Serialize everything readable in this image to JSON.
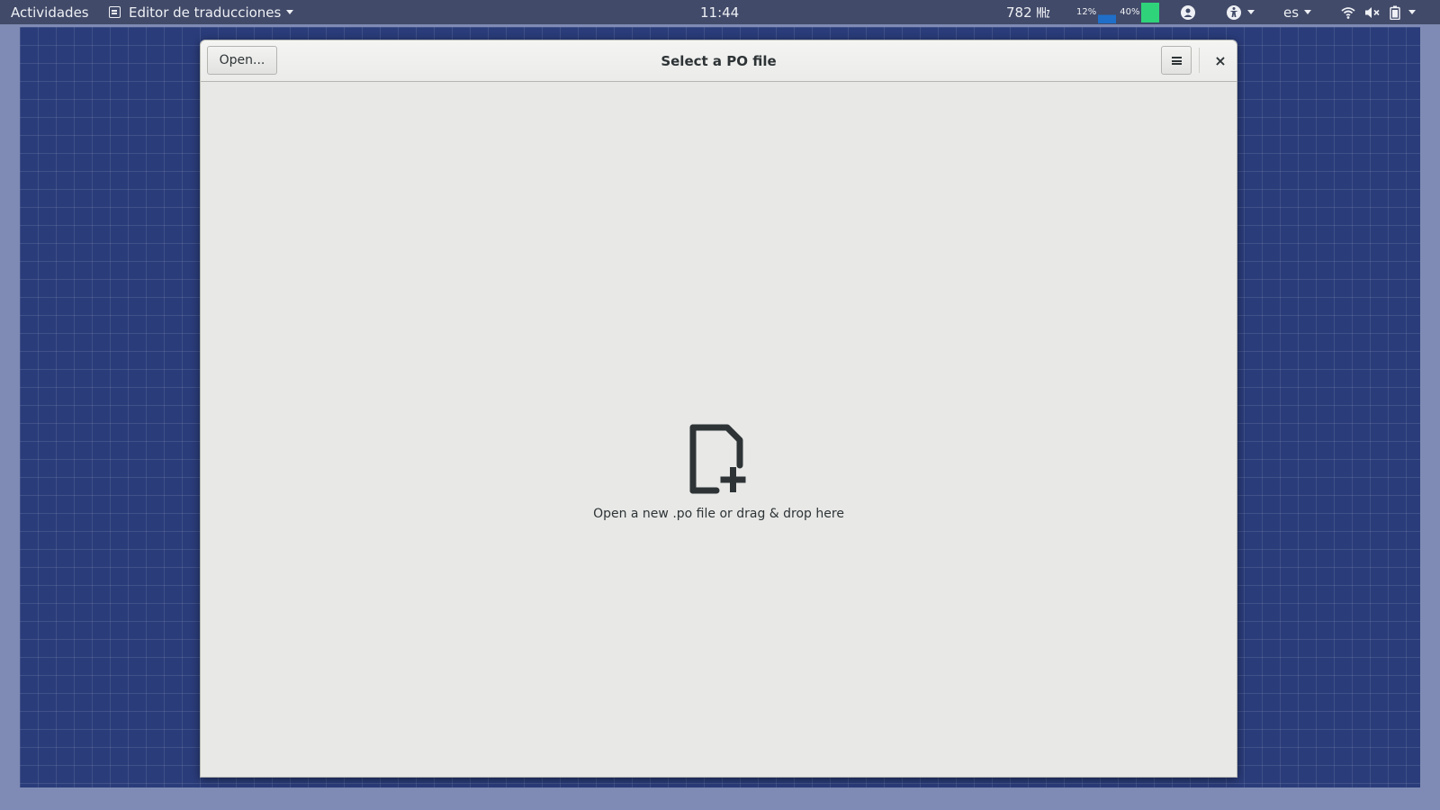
{
  "topbar": {
    "activities": "Actividades",
    "app_menu": "Editor de traducciones",
    "clock": "11:44",
    "cpu_freq": "782 ㎒",
    "cpu_load": "12%",
    "mem_load": "40%",
    "keyboard_layout": "es",
    "icons": [
      "app-icon",
      "cpu-graph",
      "memory-graph",
      "account-icon",
      "accessibility-icon",
      "wifi-icon",
      "volume-muted-icon",
      "battery-icon"
    ]
  },
  "window": {
    "title": "Select a PO file",
    "open_label": "Open...",
    "close_glyph": "×",
    "placeholder_text": "Open a new .po file or drag & drop here",
    "placeholder_icon": "document-add-icon"
  },
  "colors": {
    "topbar_bg": "#414a68",
    "wallpaper": "#2a3c7a",
    "window_bg": "#e8e8e7",
    "text": "#2e3436"
  }
}
